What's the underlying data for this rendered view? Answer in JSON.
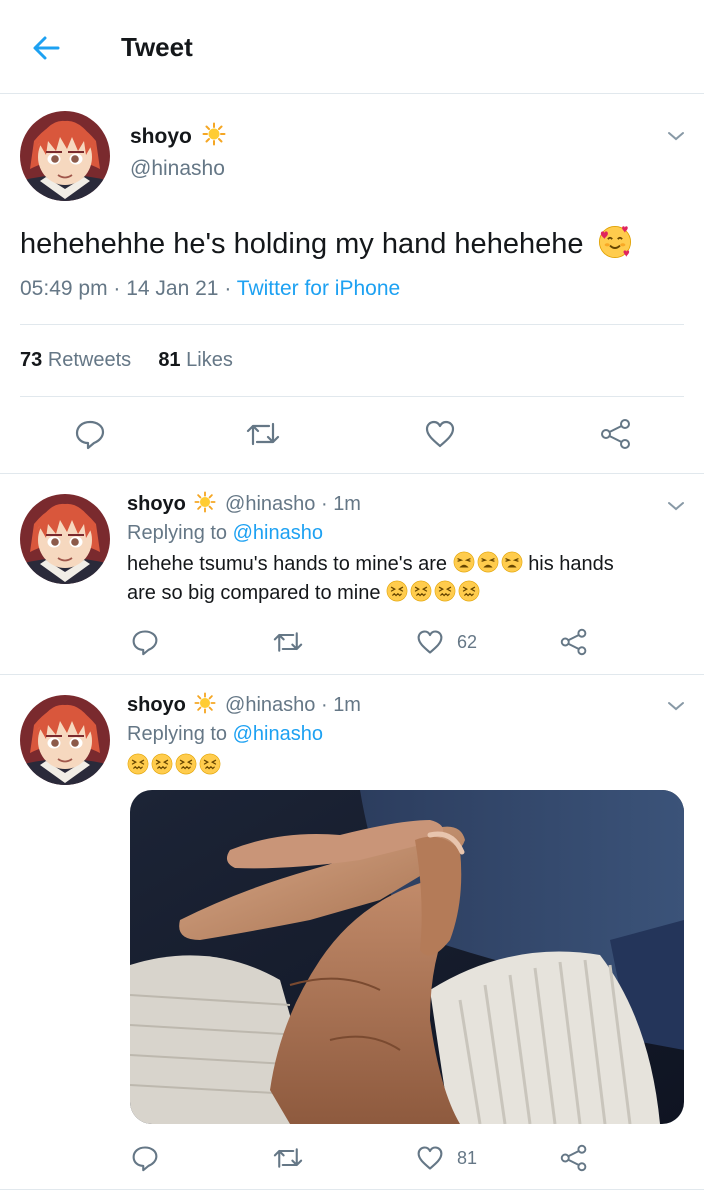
{
  "header": {
    "title": "Tweet"
  },
  "colors": {
    "accent": "#1da1f2",
    "muted": "#657786",
    "divider": "#e1e8ed"
  },
  "main_tweet": {
    "name": "shoyo",
    "handle": "@hinasho",
    "text": "hehehehhe he's holding my hand hehehehe",
    "time": "05:49 pm",
    "date": "14 Jan 21",
    "source": "Twitter for iPhone",
    "retweets": "73",
    "retweets_label": "Retweets",
    "likes": "81",
    "likes_label": "Likes"
  },
  "replies": [
    {
      "name": "shoyo",
      "handle": "@hinasho",
      "time": "1m",
      "replying_label": "Replying to",
      "replying_to": "@hinasho",
      "line1": "hehehe tsumu's hands to mine's are",
      "line1_tail": "his hands",
      "line2": "are so big compared to mine",
      "like_count": "62"
    },
    {
      "name": "shoyo",
      "handle": "@hinasho",
      "time": "1m",
      "replying_label": "Replying to",
      "replying_to": "@hinasho",
      "like_count": "81"
    }
  ],
  "icons": [
    "back-arrow-icon",
    "sun-emoji-icon",
    "chevron-down-icon",
    "reply-icon",
    "retweet-icon",
    "heart-icon",
    "share-icon",
    "smiling-face-with-hearts-emoji",
    "tired-face-emoji",
    "confounded-face-emoji"
  ]
}
